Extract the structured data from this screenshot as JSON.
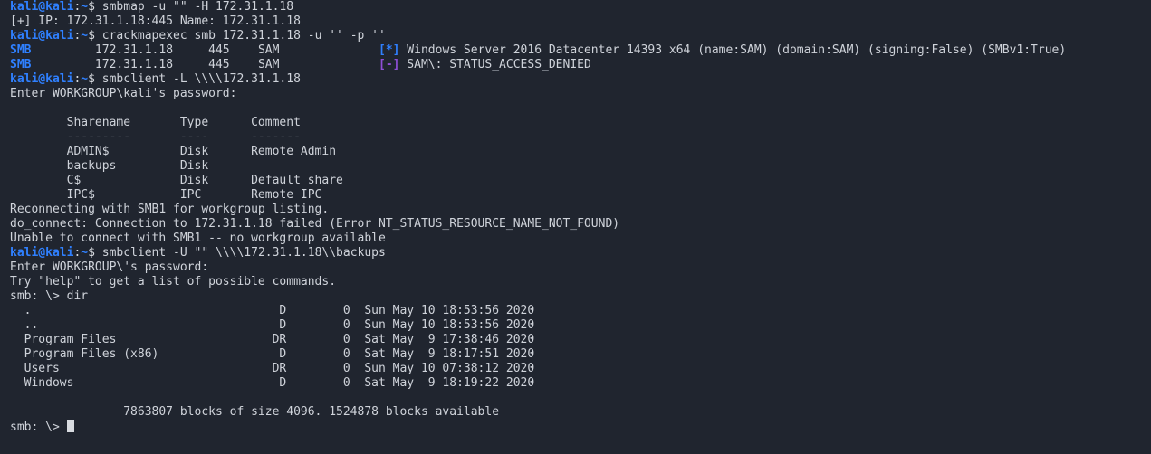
{
  "lines": [
    {
      "type": "prompt",
      "user": "kali@kali",
      "path": "~",
      "cmd": "smbmap -u \"\" -H 172.31.1.18"
    },
    {
      "type": "text",
      "text": "[+] IP: 172.31.1.18:445 Name: 172.31.1.18"
    },
    {
      "type": "prompt",
      "user": "kali@kali",
      "path": "~",
      "cmd": "crackmapexec smb 172.31.1.18 -u '' -p ''"
    },
    {
      "type": "smb",
      "tag": "SMB",
      "rest": "         172.31.1.18     445    SAM              ",
      "mark": "[*]",
      "markType": "ok",
      "msg": " Windows Server 2016 Datacenter 14393 x64 (name:SAM) (domain:SAM) (signing:False) (SMBv1:True)"
    },
    {
      "type": "smb",
      "tag": "SMB",
      "rest": "         172.31.1.18     445    SAM              ",
      "mark": "[-]",
      "markType": "bad",
      "msg": " SAM\\: STATUS_ACCESS_DENIED"
    },
    {
      "type": "prompt",
      "user": "kali@kali",
      "path": "~",
      "cmd": "smbclient -L \\\\\\\\172.31.1.18"
    },
    {
      "type": "text",
      "text": "Enter WORKGROUP\\kali's password:"
    },
    {
      "type": "text",
      "text": ""
    },
    {
      "type": "text",
      "text": "        Sharename       Type      Comment"
    },
    {
      "type": "text",
      "text": "        ---------       ----      -------"
    },
    {
      "type": "text",
      "text": "        ADMIN$          Disk      Remote Admin"
    },
    {
      "type": "text",
      "text": "        backups         Disk      "
    },
    {
      "type": "text",
      "text": "        C$              Disk      Default share"
    },
    {
      "type": "text",
      "text": "        IPC$            IPC       Remote IPC"
    },
    {
      "type": "text",
      "text": "Reconnecting with SMB1 for workgroup listing."
    },
    {
      "type": "text",
      "text": "do_connect: Connection to 172.31.1.18 failed (Error NT_STATUS_RESOURCE_NAME_NOT_FOUND)"
    },
    {
      "type": "text",
      "text": "Unable to connect with SMB1 -- no workgroup available"
    },
    {
      "type": "prompt",
      "user": "kali@kali",
      "path": "~",
      "cmd": "smbclient -U \"\" \\\\\\\\172.31.1.18\\\\backups"
    },
    {
      "type": "text",
      "text": "Enter WORKGROUP\\'s password:"
    },
    {
      "type": "text",
      "text": "Try \"help\" to get a list of possible commands."
    },
    {
      "type": "text",
      "text": "smb: \\> dir"
    },
    {
      "type": "text",
      "text": "  .                                   D        0  Sun May 10 18:53:56 2020"
    },
    {
      "type": "text",
      "text": "  ..                                  D        0  Sun May 10 18:53:56 2020"
    },
    {
      "type": "text",
      "text": "  Program Files                      DR        0  Sat May  9 17:38:46 2020"
    },
    {
      "type": "text",
      "text": "  Program Files (x86)                 D        0  Sat May  9 18:17:51 2020"
    },
    {
      "type": "text",
      "text": "  Users                              DR        0  Sun May 10 07:38:12 2020"
    },
    {
      "type": "text",
      "text": "  Windows                             D        0  Sat May  9 18:19:22 2020"
    },
    {
      "type": "text",
      "text": ""
    },
    {
      "type": "text",
      "text": "                7863807 blocks of size 4096. 1524878 blocks available"
    },
    {
      "type": "input",
      "text": "smb: \\> "
    }
  ]
}
